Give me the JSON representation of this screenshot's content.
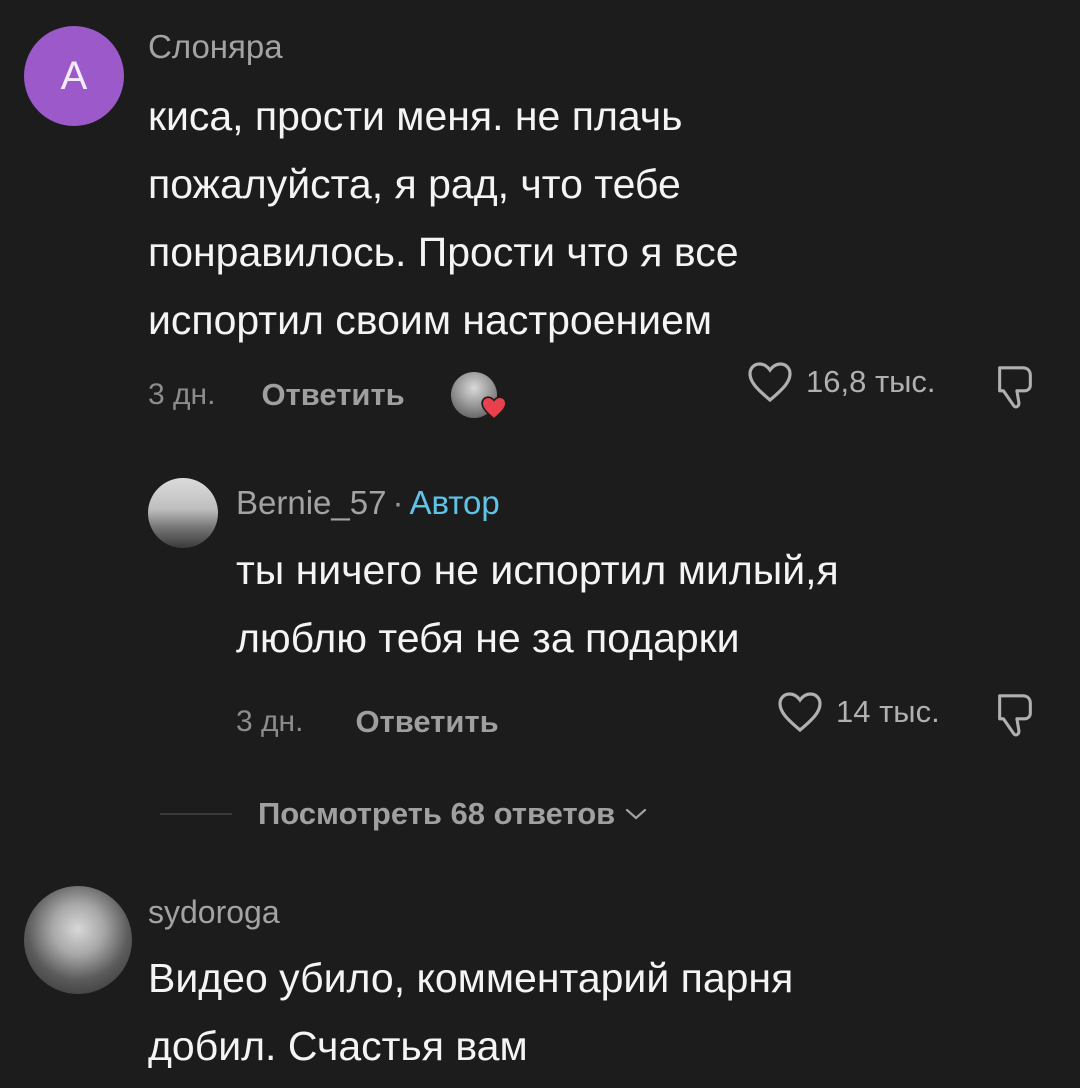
{
  "comments": [
    {
      "username": "Слоняра",
      "avatar_letter": "A",
      "avatar_color": "#9b59c9",
      "lines": [
        "киса, прости меня. не плачь",
        "пожалуйста, я рад, что тебе",
        "понравилось. Прости что я все",
        "испортил своим настроением"
      ],
      "time": "3 дн.",
      "reply_label": "Ответить",
      "likes": "16,8 тыс.",
      "creator_liked": true
    }
  ],
  "reply": {
    "username": "Bernie_57",
    "separator": "·",
    "author_badge": "Автор",
    "lines": [
      "ты ничего не испортил милый,я",
      "люблю тебя не за подарки"
    ],
    "time": "3 дн.",
    "reply_label": "Ответить",
    "likes": "14 тыс."
  },
  "view_replies": "Посмотреть 68 ответов",
  "comment2": {
    "username": "sydoroga",
    "lines": [
      "Видео убило, комментарий парня",
      "добил. Счастья вам"
    ]
  },
  "colors": {
    "background": "#1c1c1c",
    "author_badge": "#5fc3e8",
    "heart_badge": "#e8414d"
  }
}
